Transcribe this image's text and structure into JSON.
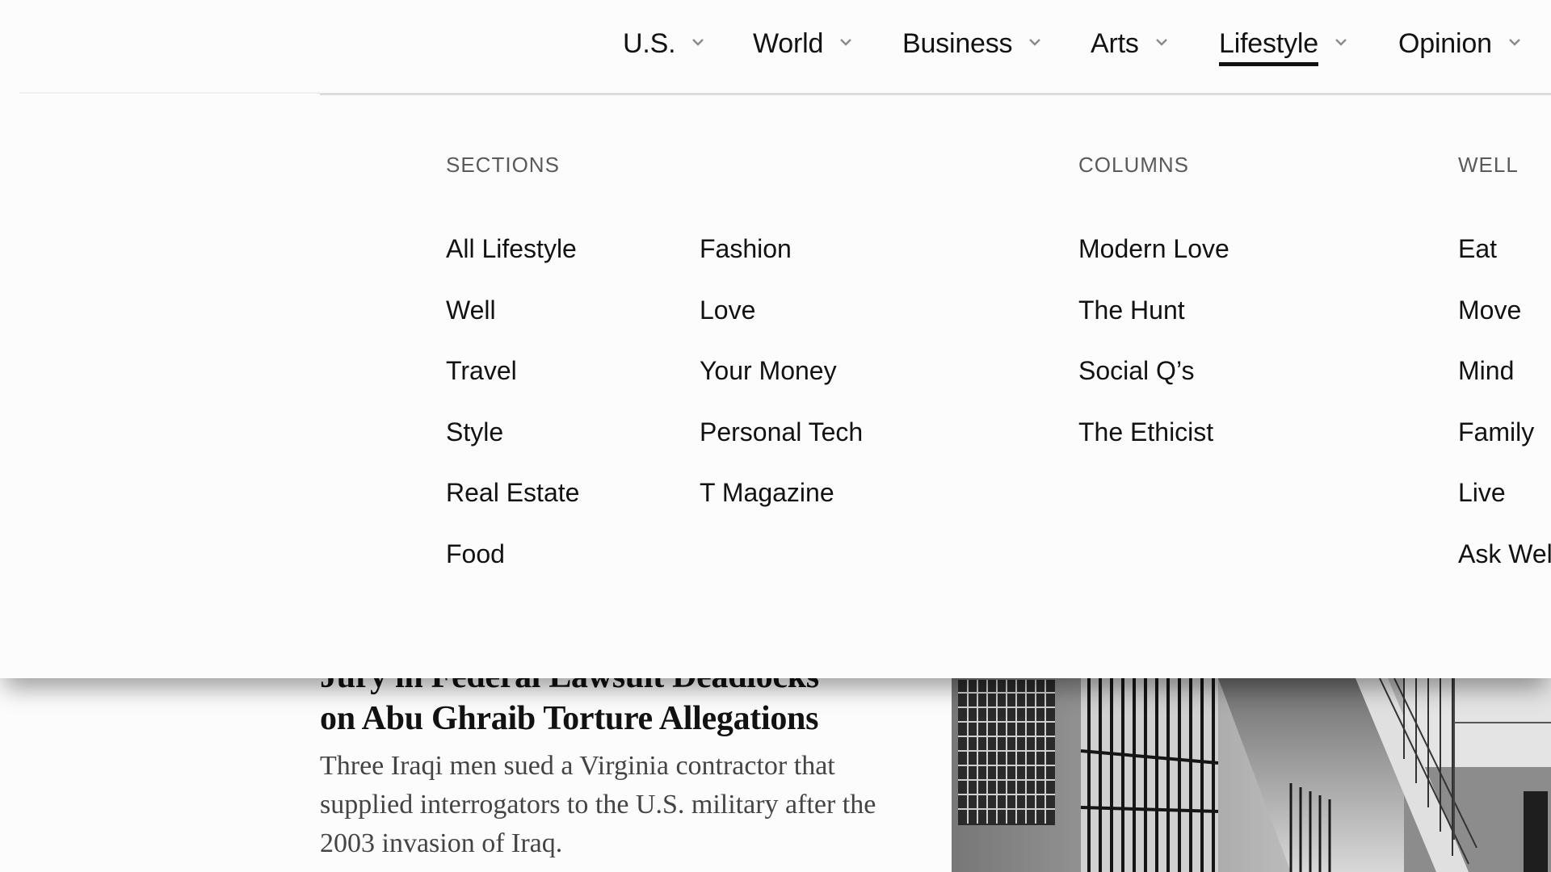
{
  "nav": {
    "items": [
      {
        "label": "U.S.",
        "active": false
      },
      {
        "label": "World",
        "active": false
      },
      {
        "label": "Business",
        "active": false
      },
      {
        "label": "Arts",
        "active": false
      },
      {
        "label": "Lifestyle",
        "active": true
      },
      {
        "label": "Opinion",
        "active": false
      }
    ],
    "chevron_icon": "chevron-down-icon"
  },
  "menu": {
    "sections": {
      "header": "SECTIONS",
      "column1": [
        "All Lifestyle",
        "Well",
        "Travel",
        "Style",
        "Real Estate",
        "Food"
      ],
      "column2": [
        "Fashion",
        "Love",
        "Your Money",
        "Personal Tech",
        "T Magazine"
      ]
    },
    "columns": {
      "header": "COLUMNS",
      "items": [
        "Modern Love",
        "The Hunt",
        "Social Q’s",
        "The Ethicist"
      ]
    },
    "well": {
      "header": "WELL",
      "items": [
        "Eat",
        "Move",
        "Mind",
        "Family",
        "Live",
        "Ask Well"
      ]
    }
  },
  "article": {
    "headline_line1": "Jury in Federal Lawsuit Deadlocks",
    "headline_line2": "on Abu Ghraib Torture Allegations",
    "summary": "Three Iraqi men sued a Virginia contractor that supplied interrogators to the U.S. military after the 2003 invasion of Iraq.",
    "image": "prison-cell-block-photo"
  }
}
